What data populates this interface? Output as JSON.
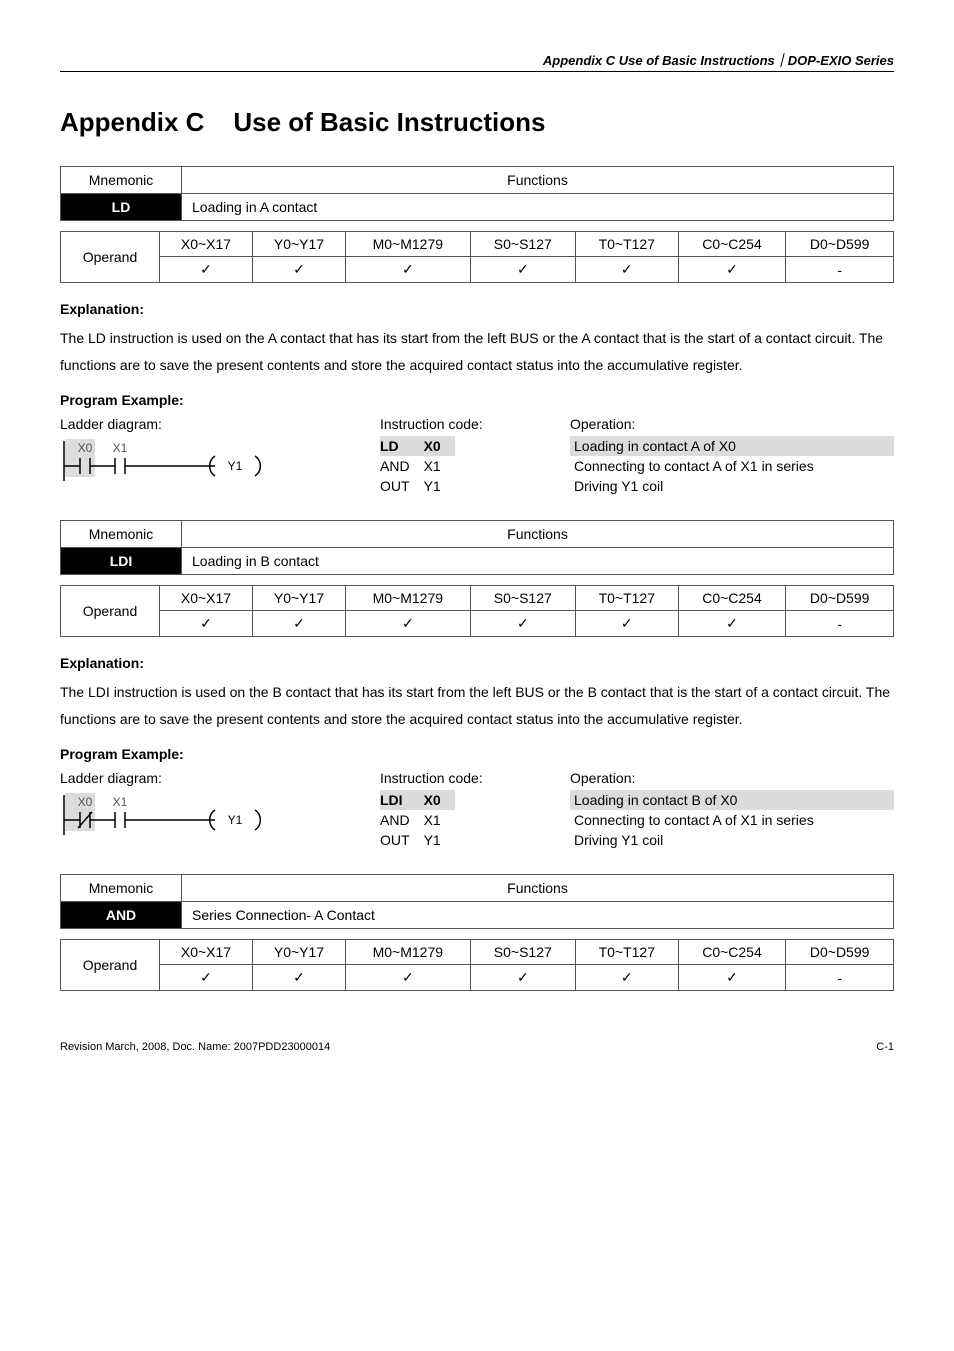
{
  "header": "Appendix C Use of Basic Instructions｜DOP-EXIO Series",
  "title": "Appendix C    Use of Basic Instructions",
  "labels": {
    "mnemonic": "Mnemonic",
    "functions": "Functions",
    "operand": "Operand",
    "explanation": "Explanation:",
    "program_example": "Program Example:",
    "ladder": "Ladder diagram:",
    "instr_code": "Instruction code:",
    "operation": "Operation:"
  },
  "operand_headers": [
    "X0~X17",
    "Y0~Y17",
    "M0~M1279",
    "S0~S127",
    "T0~T127",
    "C0~C254",
    "D0~D599"
  ],
  "check": "✓",
  "dash": "-",
  "instructions": [
    {
      "code": "LD",
      "func": "Loading in A contact",
      "operand_row": [
        "✓",
        "✓",
        "✓",
        "✓",
        "✓",
        "✓",
        "-"
      ],
      "explanation": "The LD instruction is used on the A contact that has its start from the left BUS or the A contact that is the start of a contact circuit. The functions are to save the present contents and store the acquired contact status into the accumulative register.",
      "ladder": {
        "x0": "X0",
        "x1": "X1",
        "out": "Y1",
        "nc0": false,
        "hl0": true
      },
      "code_rows": [
        {
          "c0": "LD",
          "c1": "X0",
          "hl": true
        },
        {
          "c0": "AND",
          "c1": "X1",
          "hl": false
        },
        {
          "c0": "OUT",
          "c1": "Y1",
          "hl": false
        }
      ],
      "op_rows": [
        {
          "t": "Loading in contact A of X0",
          "hl": true
        },
        {
          "t": "Connecting to contact A of X1 in series",
          "hl": false
        },
        {
          "t": "Driving Y1 coil",
          "hl": false
        }
      ]
    },
    {
      "code": "LDI",
      "func": "Loading in B contact",
      "operand_row": [
        "✓",
        "✓",
        "✓",
        "✓",
        "✓",
        "✓",
        "-"
      ],
      "explanation": "The LDI instruction is used on the B contact that has its start from the left BUS or the B contact that is the start of a contact circuit. The functions are to save the present contents and store the acquired contact status into the accumulative register.",
      "ladder": {
        "x0": "X0",
        "x1": "X1",
        "out": "Y1",
        "nc0": true,
        "hl0": true
      },
      "code_rows": [
        {
          "c0": "LDI",
          "c1": "X0",
          "hl": true
        },
        {
          "c0": "AND",
          "c1": "X1",
          "hl": false
        },
        {
          "c0": "OUT",
          "c1": "Y1",
          "hl": false
        }
      ],
      "op_rows": [
        {
          "t": "Loading in contact B of X0",
          "hl": true
        },
        {
          "t": "Connecting to contact A of X1 in series",
          "hl": false
        },
        {
          "t": "Driving Y1 coil",
          "hl": false
        }
      ]
    },
    {
      "code": "AND",
      "func": "Series Connection- A Contact",
      "operand_row": [
        "✓",
        "✓",
        "✓",
        "✓",
        "✓",
        "✓",
        "-"
      ]
    }
  ],
  "footer": {
    "left": "Revision March, 2008, Doc. Name: 2007PDD23000014",
    "right": "C-1"
  }
}
